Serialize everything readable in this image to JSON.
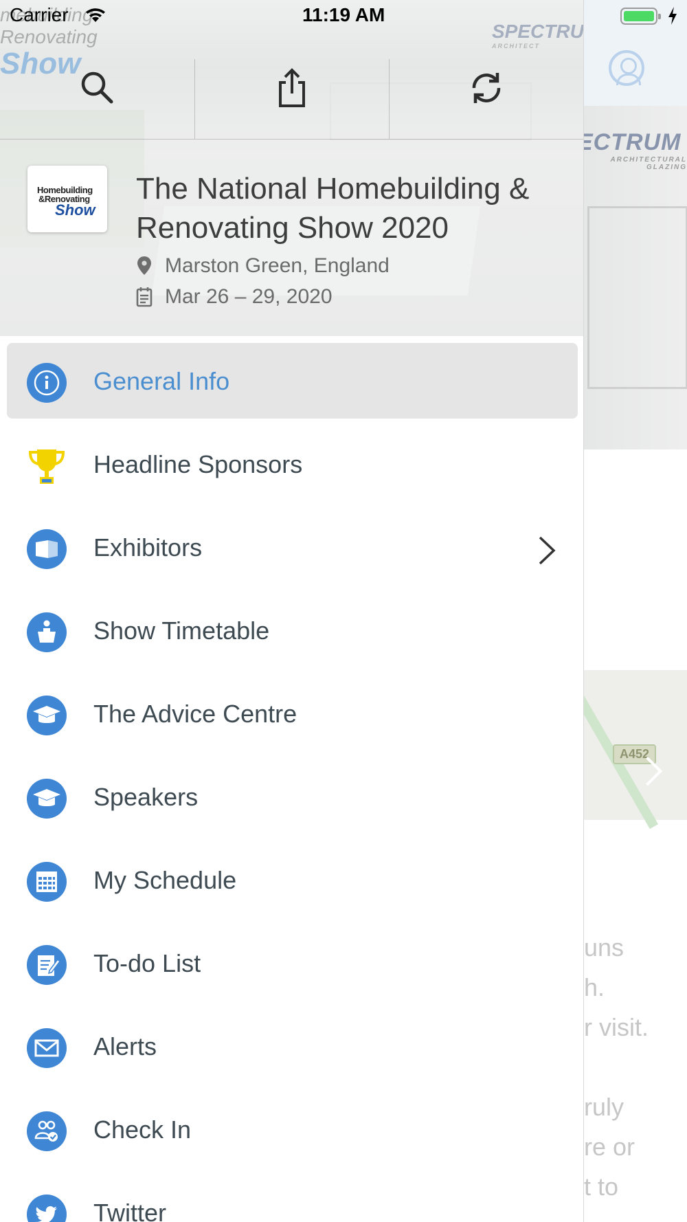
{
  "status_bar": {
    "carrier": "Carrier",
    "time": "11:19 AM"
  },
  "background": {
    "brand_mark": "ECTRUM",
    "brand_sub": "ARCHITECTURAL GLAZING",
    "map_road_label": "A452",
    "text_fragments": [
      "uns",
      "h.",
      "r visit.",
      "ruly",
      "re or",
      "t to"
    ]
  },
  "drawer": {
    "watermark_logo": [
      "mebuilding",
      "Renovating",
      "Show"
    ],
    "watermark_brand": "SPECTRU",
    "watermark_brand_sub": "ARCHITECT",
    "actions": [
      {
        "name": "search",
        "icon": "search-icon"
      },
      {
        "name": "share",
        "icon": "share-icon"
      },
      {
        "name": "refresh",
        "icon": "refresh-icon"
      }
    ],
    "event": {
      "logo_lines": [
        "Homebuilding",
        "&Renovating",
        "Show"
      ],
      "title": "The National Homebuilding & Renovating Show 2020",
      "location": "Marston Green, England",
      "dates": "Mar 26 – 29, 2020"
    },
    "menu": [
      {
        "label": "General Info",
        "icon": "info-icon",
        "selected": true
      },
      {
        "label": "Headline Sponsors",
        "icon": "trophy-icon"
      },
      {
        "label": "Exhibitors",
        "icon": "booth-icon",
        "chevron": true
      },
      {
        "label": "Show Timetable",
        "icon": "speaker-podium-icon"
      },
      {
        "label": "The Advice Centre",
        "icon": "graduation-cap-icon"
      },
      {
        "label": "Speakers",
        "icon": "graduation-cap-icon"
      },
      {
        "label": "My Schedule",
        "icon": "calendar-grid-icon"
      },
      {
        "label": "To-do List",
        "icon": "notepad-icon"
      },
      {
        "label": "Alerts",
        "icon": "envelope-icon"
      },
      {
        "label": "Check In",
        "icon": "check-in-icon"
      },
      {
        "label": "Twitter",
        "icon": "twitter-icon"
      }
    ]
  },
  "colors": {
    "accent_blue": "#4a8ed0",
    "icon_blue": "#3f86d4",
    "selected_row_bg": "#e5e5e5",
    "trophy_yellow": "#f2d300",
    "battery_green": "#4cd964"
  }
}
